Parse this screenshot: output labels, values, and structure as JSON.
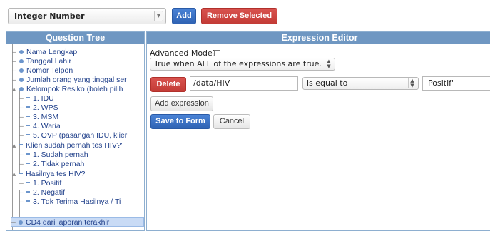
{
  "toolbar": {
    "question_type": "Integer Number",
    "add_label": "Add",
    "remove_label": "Remove Selected"
  },
  "tree_panel": {
    "title": "Question Tree",
    "nodes": [
      {
        "label": "Nama Lengkap"
      },
      {
        "label": "Tanggal Lahir"
      },
      {
        "label": "Nomor Telpon"
      },
      {
        "label": "Jumlah orang yang tinggal ser"
      },
      {
        "label": "Kelompok Resiko (boleh pilih"
      },
      {
        "label": "1. IDU"
      },
      {
        "label": "2. WPS"
      },
      {
        "label": "3. MSM"
      },
      {
        "label": "4. Waria"
      },
      {
        "label": "5. OVP (pasangan IDU, klier"
      },
      {
        "label": "Klien sudah pernah tes HIV?\""
      },
      {
        "label": "1. Sudah pernah"
      },
      {
        "label": "2. Tidak pernah"
      },
      {
        "label": "Hasilnya tes HIV?"
      },
      {
        "label": "1. Positif"
      },
      {
        "label": "2. Negatif"
      },
      {
        "label": "3. Tdk Terima Hasilnya / Ti"
      },
      {
        "label": "CD4 dari laporan terakhir"
      }
    ]
  },
  "expression_panel": {
    "title": "Expression Editor",
    "advanced_mode_label": "Advanced Mode?",
    "match_mode": "True when ALL of the expressions are true.",
    "row": {
      "delete_label": "Delete",
      "path": "/data/HIV",
      "operator": "is equal to",
      "value": "'Positif'"
    },
    "add_expression_label": "Add expression",
    "save_label": "Save to Form",
    "cancel_label": "Cancel"
  }
}
